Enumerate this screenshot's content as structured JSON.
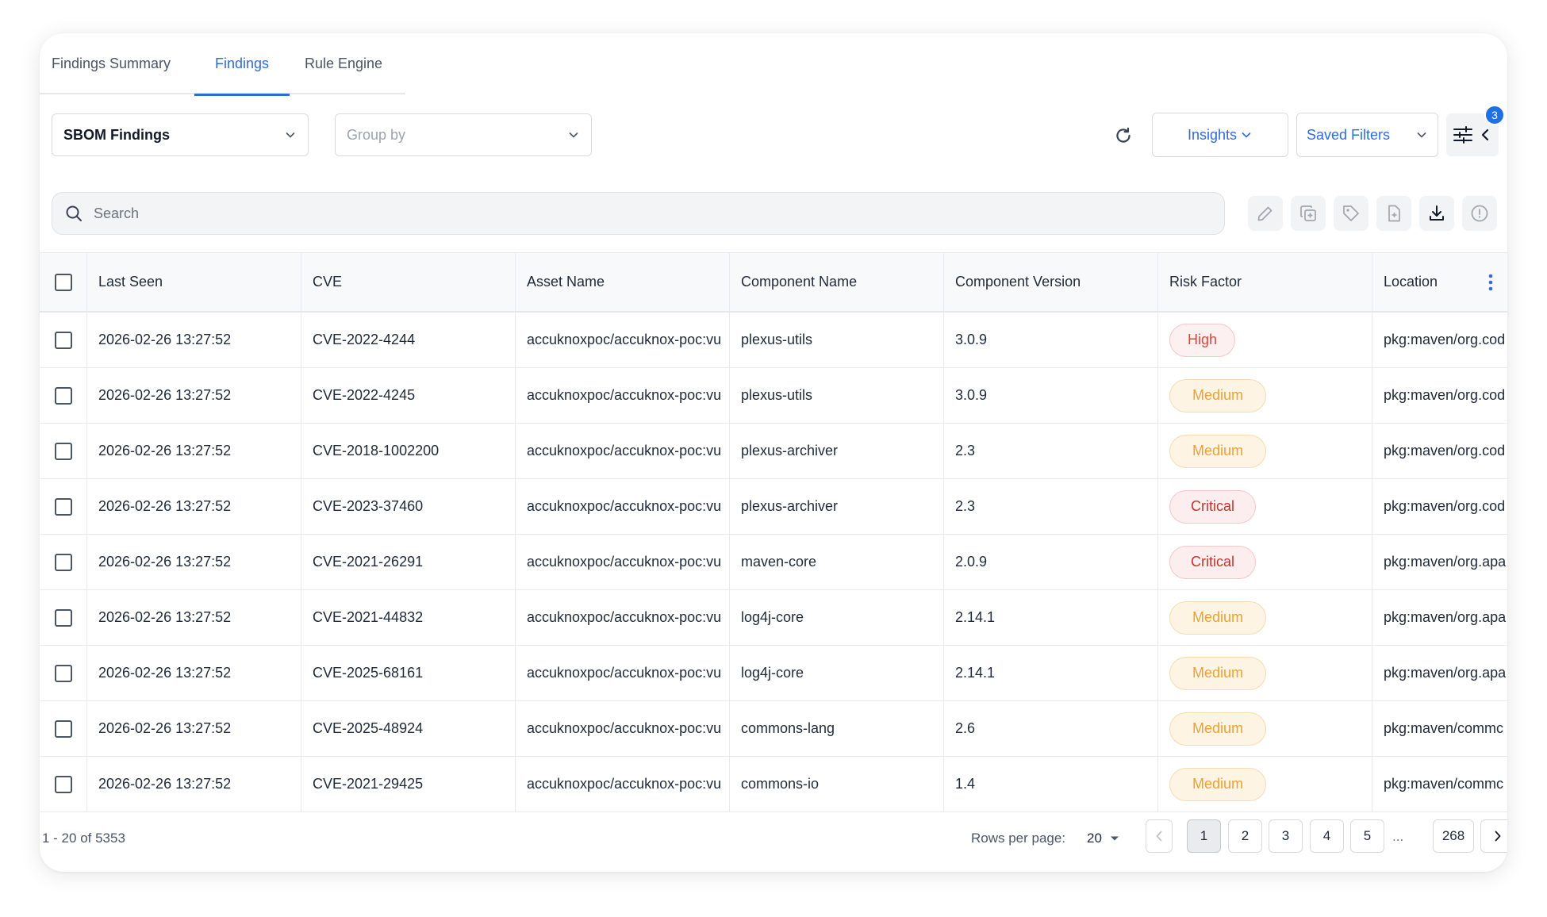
{
  "tabs": [
    {
      "label": "Findings Summary"
    },
    {
      "label": "Findings"
    },
    {
      "label": "Rule Engine"
    }
  ],
  "toolbar": {
    "finding_type": "SBOM Findings",
    "group_by_placeholder": "Group by",
    "insights_label": "Insights",
    "saved_filters_label": "Saved Filters",
    "filter_badge_count": "3"
  },
  "search": {
    "placeholder": "Search"
  },
  "table": {
    "columns": [
      "Last Seen",
      "CVE",
      "Asset Name",
      "Component Name",
      "Component Version",
      "Risk Factor",
      "Location"
    ],
    "rows": [
      {
        "last_seen": "2026-02-26 13:27:52",
        "cve": "CVE-2022-4244",
        "asset": "accuknoxpoc/accuknox-poc:vu",
        "component": "plexus-utils",
        "version": "3.0.9",
        "risk": "High",
        "location": "pkg:maven/org.cod"
      },
      {
        "last_seen": "2026-02-26 13:27:52",
        "cve": "CVE-2022-4245",
        "asset": "accuknoxpoc/accuknox-poc:vu",
        "component": "plexus-utils",
        "version": "3.0.9",
        "risk": "Medium",
        "location": "pkg:maven/org.cod"
      },
      {
        "last_seen": "2026-02-26 13:27:52",
        "cve": "CVE-2018-1002200",
        "asset": "accuknoxpoc/accuknox-poc:vu",
        "component": "plexus-archiver",
        "version": "2.3",
        "risk": "Medium",
        "location": "pkg:maven/org.cod"
      },
      {
        "last_seen": "2026-02-26 13:27:52",
        "cve": "CVE-2023-37460",
        "asset": "accuknoxpoc/accuknox-poc:vu",
        "component": "plexus-archiver",
        "version": "2.3",
        "risk": "Critical",
        "location": "pkg:maven/org.cod"
      },
      {
        "last_seen": "2026-02-26 13:27:52",
        "cve": "CVE-2021-26291",
        "asset": "accuknoxpoc/accuknox-poc:vu",
        "component": "maven-core",
        "version": "2.0.9",
        "risk": "Critical",
        "location": "pkg:maven/org.apa"
      },
      {
        "last_seen": "2026-02-26 13:27:52",
        "cve": "CVE-2021-44832",
        "asset": "accuknoxpoc/accuknox-poc:vu",
        "component": "log4j-core",
        "version": "2.14.1",
        "risk": "Medium",
        "location": "pkg:maven/org.apa"
      },
      {
        "last_seen": "2026-02-26 13:27:52",
        "cve": "CVE-2025-68161",
        "asset": "accuknoxpoc/accuknox-poc:vu",
        "component": "log4j-core",
        "version": "2.14.1",
        "risk": "Medium",
        "location": "pkg:maven/org.apa"
      },
      {
        "last_seen": "2026-02-26 13:27:52",
        "cve": "CVE-2025-48924",
        "asset": "accuknoxpoc/accuknox-poc:vu",
        "component": "commons-lang",
        "version": "2.6",
        "risk": "Medium",
        "location": "pkg:maven/commc"
      },
      {
        "last_seen": "2026-02-26 13:27:52",
        "cve": "CVE-2021-29425",
        "asset": "accuknoxpoc/accuknox-poc:vu",
        "component": "commons-io",
        "version": "1.4",
        "risk": "Medium",
        "location": "pkg:maven/commc"
      }
    ]
  },
  "footer": {
    "count_text": "1 - 20 of 5353",
    "rows_per_page_label": "Rows per page:",
    "rows_per_page_value": "20",
    "pages": [
      "1",
      "2",
      "3",
      "4",
      "5"
    ],
    "ellipsis": "...",
    "last_page": "268",
    "current_page": "1"
  },
  "colors": {
    "accent": "#2f6bd9",
    "badge": "#1f6fe5",
    "risk_high": "#e0453a",
    "risk_medium": "#f0a030",
    "risk_critical": "#c0362c"
  }
}
